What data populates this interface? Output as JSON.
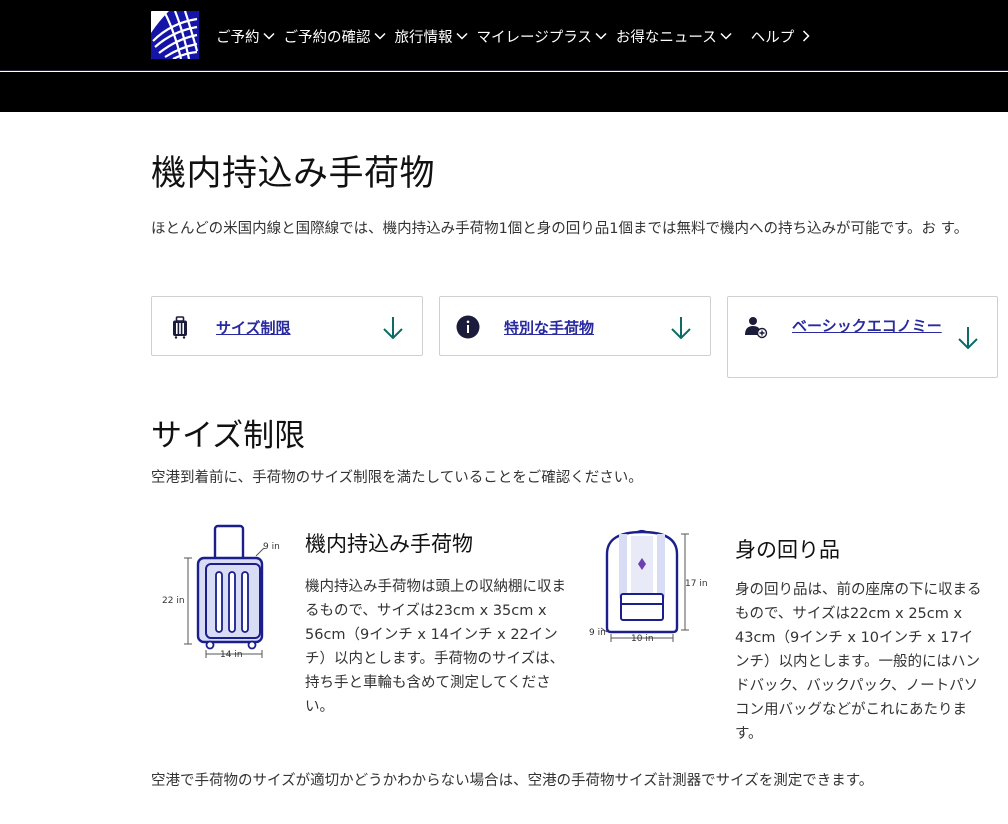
{
  "nav": {
    "items": [
      {
        "label": "ご予約",
        "has_dropdown": true
      },
      {
        "label": "ご予約の確認",
        "has_dropdown": true
      },
      {
        "label": "旅行情報",
        "has_dropdown": true
      },
      {
        "label": "マイレージプラス",
        "has_dropdown": true
      },
      {
        "label": "お得なニュース",
        "has_dropdown": true
      }
    ],
    "help_label": "ヘルプ"
  },
  "page": {
    "title": "機内持込み手荷物",
    "intro": "ほとんどの米国内線と国際線では、機内持込み手荷物1個と身の回り品1個までは無料で機内への持ち込みが可能です。お す。"
  },
  "cards": [
    {
      "label": "サイズ制限",
      "icon": "suitcase-icon"
    },
    {
      "label": "特別な手荷物",
      "icon": "info-icon"
    },
    {
      "label": "ベーシックエコノミー",
      "icon": "person-plus-icon"
    }
  ],
  "size_section": {
    "title": "サイズ制限",
    "subtitle": "空港到着前に、手荷物のサイズ制限を満たしていることをご確認ください。",
    "carry_on": {
      "title": "機内持込み手荷物",
      "description": "機内持込み手荷物は頭上の収納棚に収まるもので、サイズは23cm x 35cm x 56cm（9インチ x 14インチ x 22インチ）以内とします。手荷物のサイズは、持ち手と車輪も含めて測定してください。",
      "dims": {
        "height": "22 in",
        "width": "14 in",
        "depth": "9 in"
      }
    },
    "personal_item": {
      "title": "身の回り品",
      "description": "身の回り品は、前の座席の下に収まるもので、サイズは22cm x 25cm x 43cm（9インチ x 10インチ x 17インチ）以内とします。一般的にはハンドバック、バックパック、ノートパソコン用バッグなどがこれにあたります。",
      "dims": {
        "height": "17 in",
        "width": "10 in",
        "depth": "9 in"
      }
    }
  },
  "footer_text": "空港で手荷物のサイズが適切かどうかわからない場合は、空港の手荷物サイズ計測器でサイズを測定できます。",
  "colors": {
    "nav_bg": "#000000",
    "link": "#2a2aa0",
    "arrow": "#0d6b66",
    "illus_blue": "#1a1f8c",
    "illus_fill": "#d8dcf5",
    "illus_purple": "#6e3fb0"
  }
}
